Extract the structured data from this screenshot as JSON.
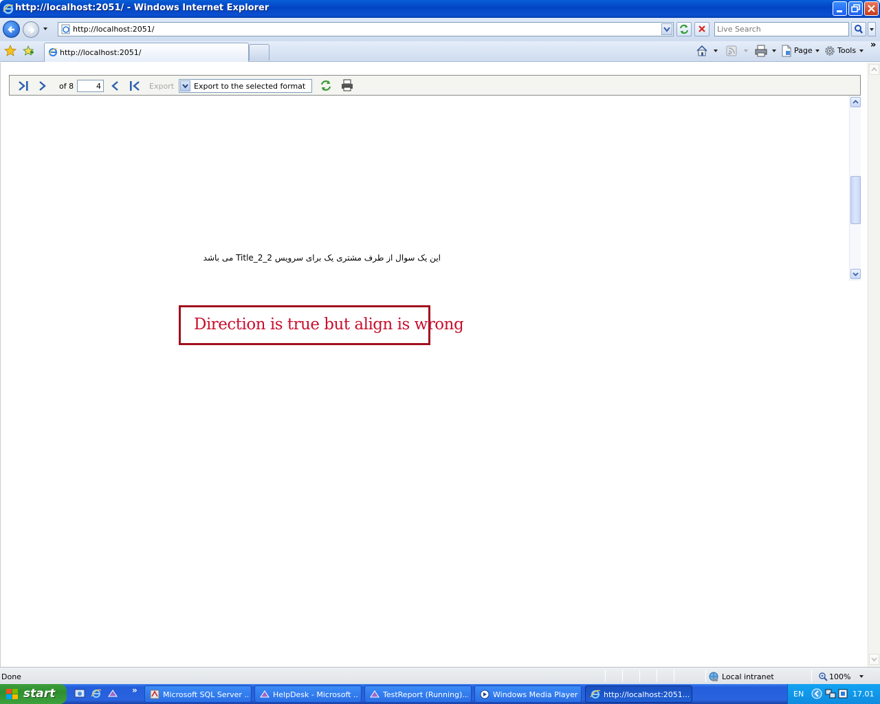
{
  "window": {
    "title": "http://localhost:2051/ - Windows Internet Explorer"
  },
  "address": {
    "url": "http://localhost:2051/"
  },
  "search": {
    "placeholder": "Live Search"
  },
  "tabs": [
    {
      "label": "http://localhost:2051/"
    }
  ],
  "command_bar": {
    "page_label": "Page",
    "tools_label": "Tools",
    "more": "»"
  },
  "report_toolbar": {
    "of_label": "of 8",
    "page_value": "4",
    "export_label": "Export",
    "export_selected": "Export to the selected format"
  },
  "report": {
    "persian_line": "این یک سوال از طرف مشتری یک برای سرویس Title_2_2 می باشد"
  },
  "callout": {
    "text": "Direction is true but align is wrong",
    "color": "#c8102e"
  },
  "status": {
    "text": "Done",
    "zone": "Local intranet",
    "zoom": "100%"
  },
  "taskbar": {
    "start_label": "start",
    "more": "»",
    "tasks": [
      {
        "label": "Microsoft SQL Server ..."
      },
      {
        "label": "HelpDesk - Microsoft ..."
      },
      {
        "label": "TestReport (Running)..."
      },
      {
        "label": "Windows Media Player"
      },
      {
        "label": "http://localhost:2051..."
      }
    ],
    "language": "EN",
    "clock": "17.01"
  }
}
